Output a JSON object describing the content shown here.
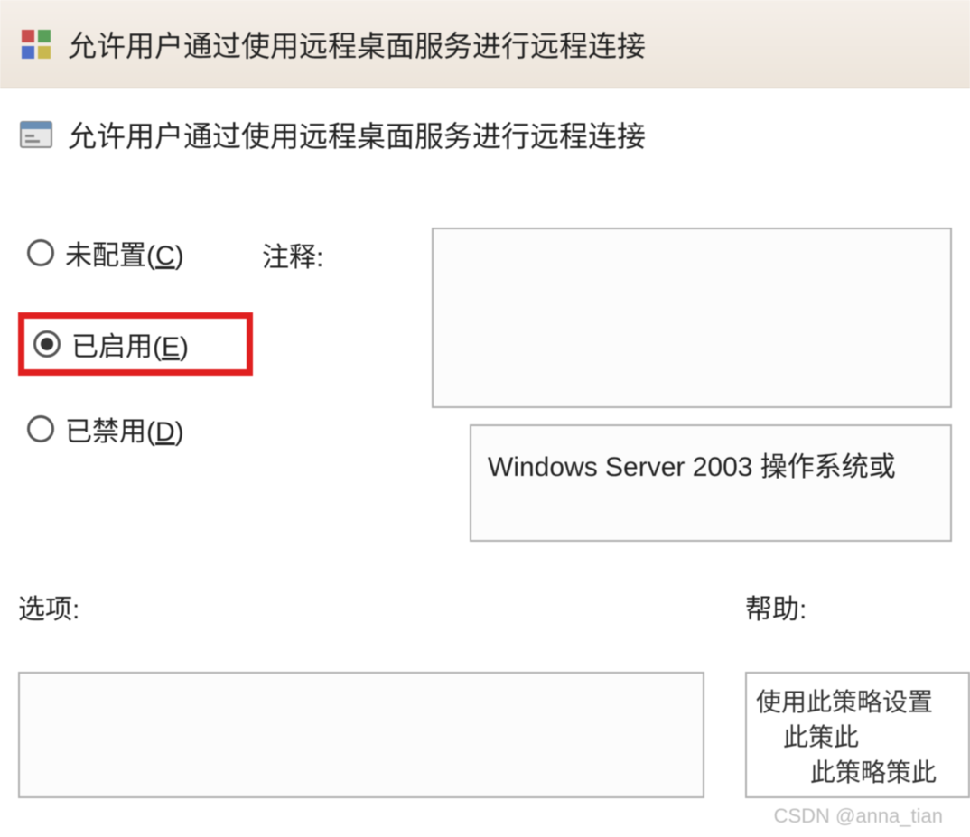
{
  "titlebar": {
    "title": "允许用户通过使用远程桌面服务进行远程连接"
  },
  "subtitle": {
    "text": "允许用户通过使用远程桌面服务进行远程连接"
  },
  "radio": {
    "not_configured": {
      "label_prefix": "未配置(",
      "hotkey": "C",
      "label_suffix": ")"
    },
    "enabled": {
      "label_prefix": "已启用(",
      "hotkey": "E",
      "label_suffix": ")"
    },
    "disabled": {
      "label_prefix": "已禁用(",
      "hotkey": "D",
      "label_suffix": ")"
    }
  },
  "comment": {
    "label": "注释:",
    "value": ""
  },
  "os_box": {
    "text": "Windows Server 2003 操作系统或"
  },
  "lower": {
    "options_label": "选项:",
    "help_label": "帮助:"
  },
  "help_text": {
    "line1": "使用此策略设置",
    "line2": "此策此",
    "line3": "此策略策此"
  },
  "watermark": "CSDN @anna_tian"
}
